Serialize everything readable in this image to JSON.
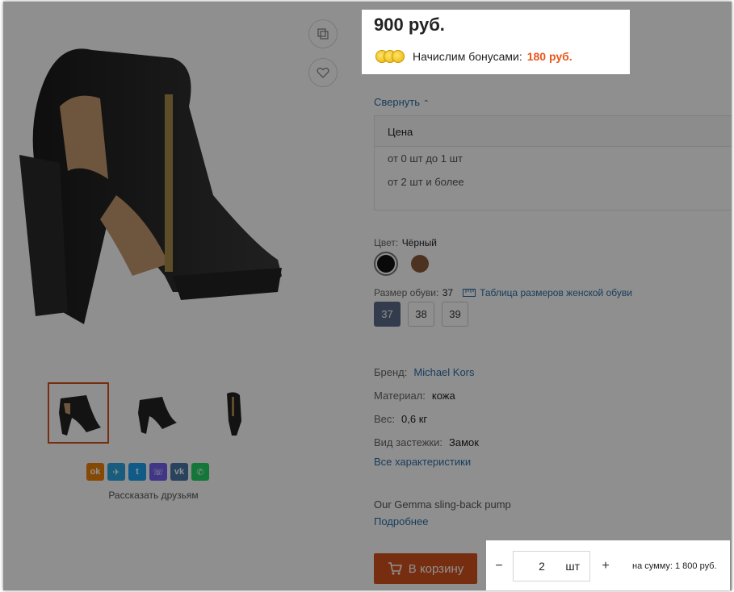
{
  "product": {
    "price": "900 руб.",
    "bonus_label": "Начислим бонусами:",
    "bonus_amount": "180 руб.",
    "collapse_label": "Свернуть",
    "price_table": {
      "header": "Цена",
      "rows": [
        "от 0 шт до 1 шт",
        "от 2 шт и более"
      ]
    },
    "color": {
      "label": "Цвет:",
      "value": "Чёрный",
      "swatches": [
        "#111111",
        "#8a5a3b"
      ]
    },
    "size": {
      "label": "Размер обуви:",
      "value": "37",
      "table_link": "Таблица размеров женской обуви",
      "options": [
        "37",
        "38",
        "39"
      ]
    },
    "props": [
      {
        "key": "Бренд:",
        "value": "Michael Kors"
      },
      {
        "key": "Материал:",
        "value": "кожа"
      },
      {
        "key": "Вес:",
        "value": "0,6 кг"
      },
      {
        "key": "Вид застежки:",
        "value": "Замок"
      }
    ],
    "all_chars_link": "Все характеристики",
    "description": "Our Gemma sling-back pump",
    "more_link": "Подробнее",
    "cart_button": "В корзину",
    "qty": {
      "value": "2",
      "unit": "шт",
      "minus": "−",
      "plus": "+"
    },
    "total": "на сумму: 1 800 руб."
  },
  "gallery": {
    "share_label": "Рассказать друзьям",
    "social": [
      {
        "icon": "odnoklassniki-icon",
        "color": "#ee8208"
      },
      {
        "icon": "telegram-icon",
        "color": "#2ca5e0"
      },
      {
        "icon": "twitter-icon",
        "color": "#1da1f2"
      },
      {
        "icon": "viber-icon",
        "color": "#7360f2"
      },
      {
        "icon": "vk-icon",
        "color": "#4a76a8"
      },
      {
        "icon": "whatsapp-icon",
        "color": "#25d366"
      }
    ]
  },
  "colors": {
    "accent": "#d4521e",
    "link": "#2b6ea6",
    "bonus": "#e8571a",
    "size_active": "#596b88"
  }
}
